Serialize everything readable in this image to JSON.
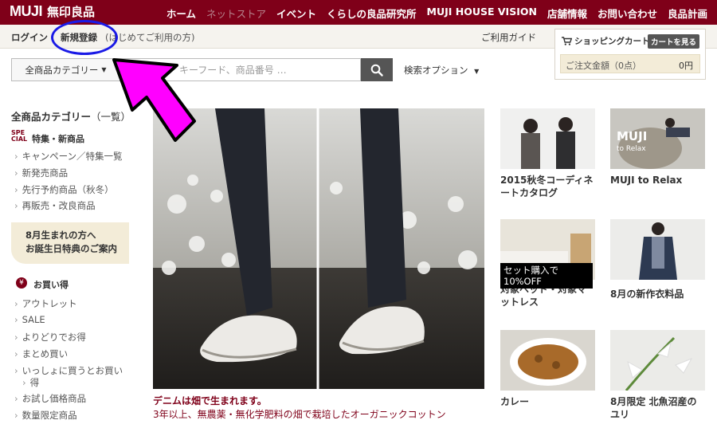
{
  "header": {
    "logo_en": "MUJI",
    "logo_jp": "無印良品",
    "nav": [
      {
        "label": "ホーム",
        "dim": false
      },
      {
        "label": "ネットストア",
        "dim": true
      },
      {
        "label": "イベント",
        "dim": false
      },
      {
        "label": "くらしの良品研究所",
        "dim": false
      },
      {
        "label": "MUJI HOUSE VISION",
        "dim": false
      },
      {
        "label": "店舗情報",
        "dim": false
      },
      {
        "label": "お問い合わせ",
        "dim": false
      },
      {
        "label": "良品計画",
        "dim": false
      }
    ]
  },
  "subbar": {
    "login": "ログイン",
    "register": "新規登録",
    "first_time": "(はじめてご利用の方)",
    "guide": "ご利用ガイド"
  },
  "cart": {
    "title": "ショッピングカート",
    "see_button": "カートを見る",
    "total_label": "ご注文金額（0点）",
    "total_amount": "0円"
  },
  "search": {
    "category": "全商品カテゴリー",
    "placeholder": "キーフード、商品番号 …",
    "options": "検索オプション"
  },
  "sidebar": {
    "heading": "全商品カテゴリー",
    "heading_suffix": "（一覧）",
    "special_icon": "SPE CIAL",
    "special_title": "特集・新商品",
    "special_items": [
      "キャンペーン／特集一覧",
      "新発売商品",
      "先行予約商品（秋冬）",
      "再販売・改良商品"
    ],
    "birthday_line1": "8月生まれの方へ",
    "birthday_line2": "お誕生日特典のご案内",
    "deal_icon": "¥",
    "deal_title": "お買い得",
    "deal_items": [
      "アウトレット",
      "SALE",
      "よりどりでお得",
      "まとめ買い",
      "いっしょに買うとお買い",
      "得",
      "お試し価格商品",
      "数量限定商品"
    ]
  },
  "hero": {
    "title": "デニムは畑で生まれます。",
    "subtitle": "3年以上、無農薬・無化学肥料の畑で栽培したオーガニックコットン"
  },
  "tiles": [
    {
      "caption": "2015秋冬コーディネートカタログ"
    },
    {
      "caption": "MUJI to Relax",
      "overlay": "MUJI",
      "overlay2": "to Relax"
    },
    {
      "caption": "対象ベッド・対象マットレス",
      "badge": "セット購入で 10%OFF"
    },
    {
      "caption": "8月の新作衣料品"
    },
    {
      "caption": "カレー"
    },
    {
      "caption": "8月限定 北魚沼産のユリ"
    }
  ],
  "colors": {
    "brand": "#7f0019",
    "annotation_arrow": "#ff00ff",
    "annotation_circle": "#1a1ae6"
  }
}
